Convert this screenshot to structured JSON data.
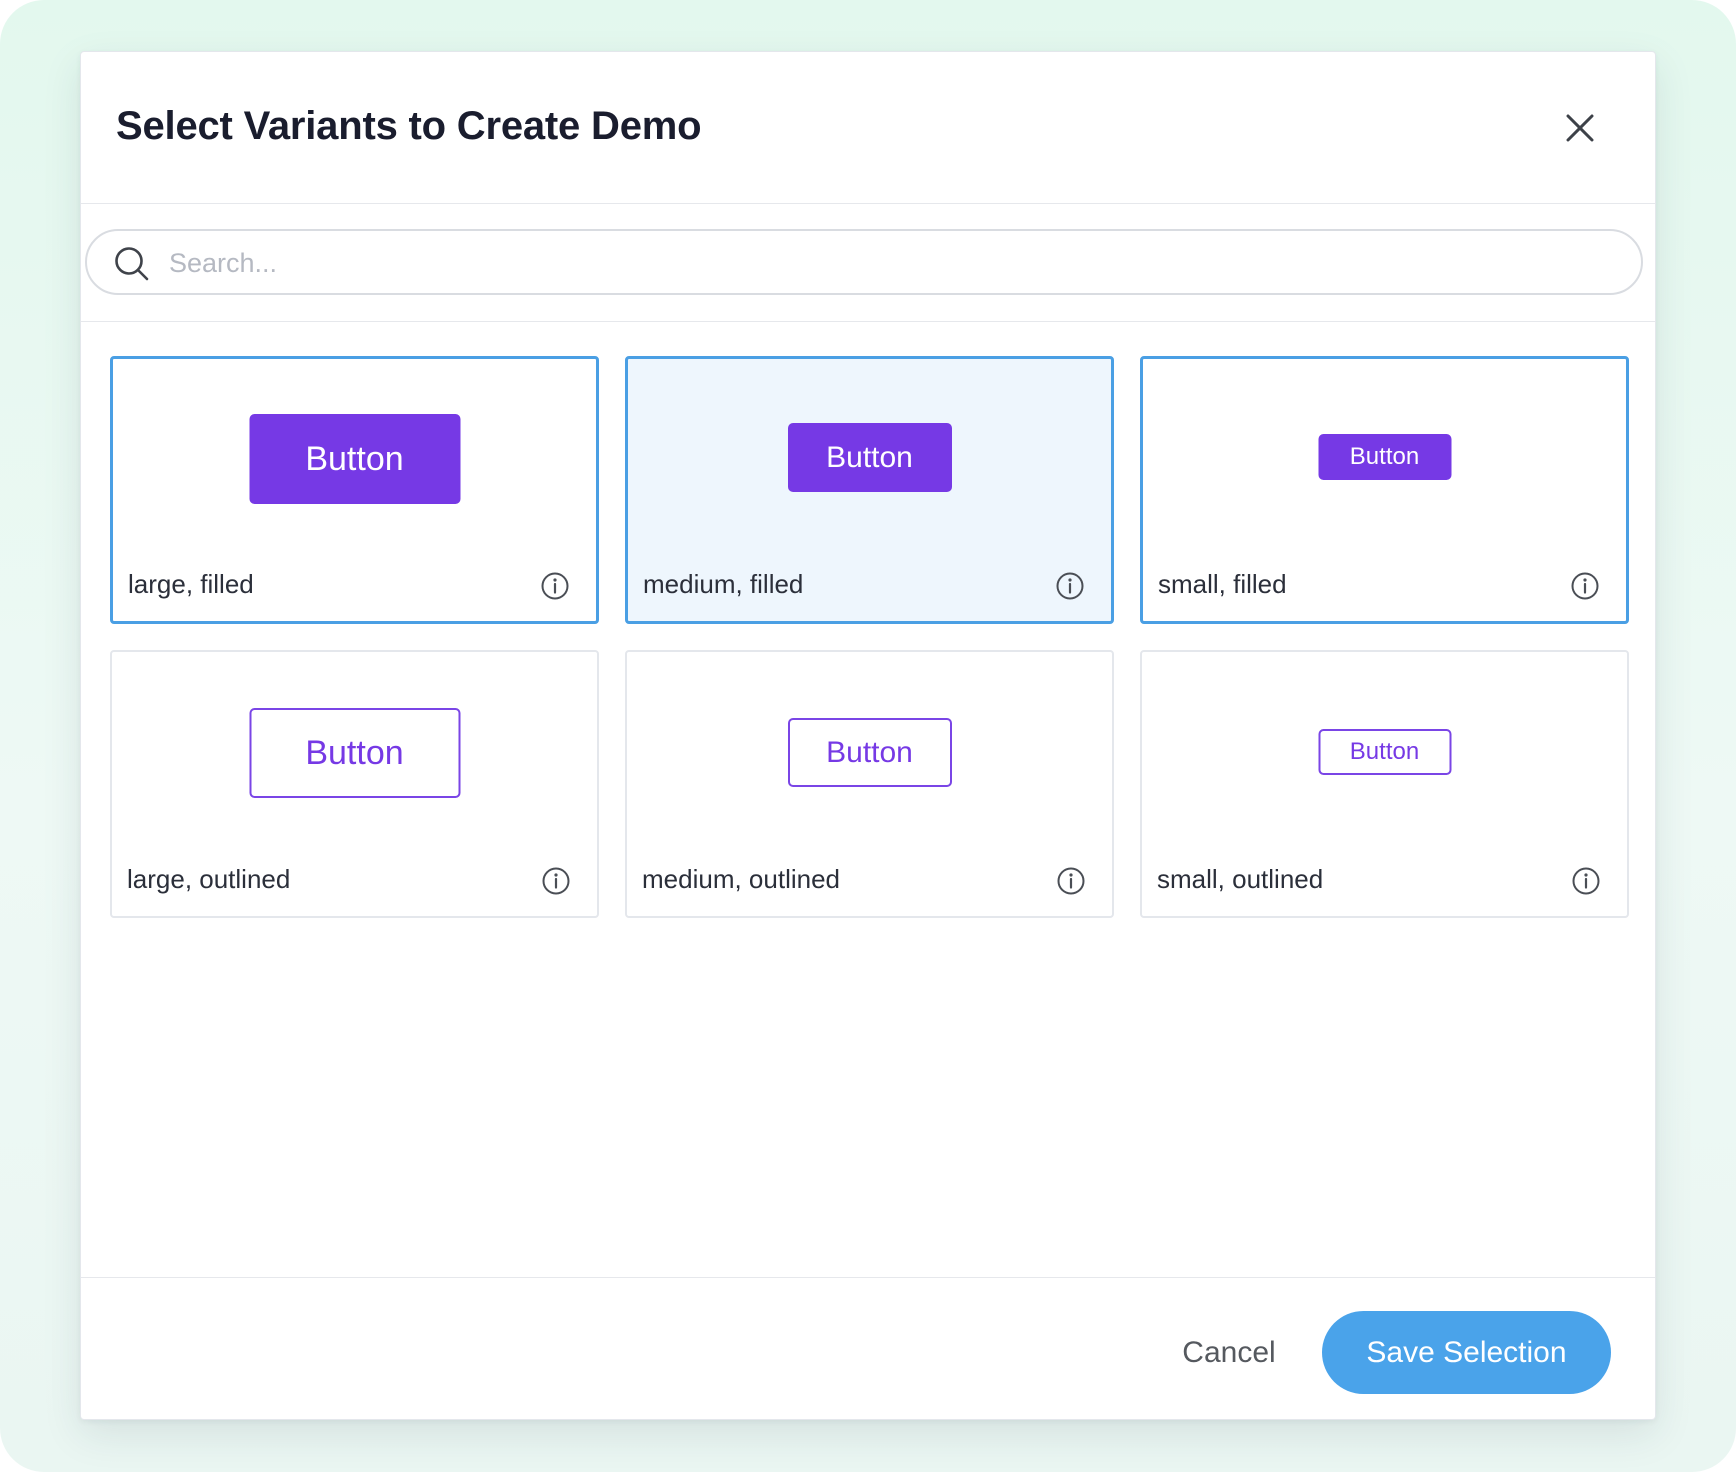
{
  "dialog": {
    "title": "Select Variants to Create Demo",
    "close_icon": "close-icon"
  },
  "search": {
    "placeholder": "Search...",
    "value": "",
    "icon": "search-icon"
  },
  "variants": [
    {
      "label": "large, filled",
      "button_text": "Button",
      "size": "large",
      "style": "filled",
      "selected": true
    },
    {
      "label": "medium, filled",
      "button_text": "Button",
      "size": "medium",
      "style": "filled",
      "selected": true
    },
    {
      "label": "small, filled",
      "button_text": "Button",
      "size": "small",
      "style": "filled",
      "selected": true
    },
    {
      "label": "large, outlined",
      "button_text": "Button",
      "size": "large",
      "style": "outlined",
      "selected": false
    },
    {
      "label": "medium, outlined",
      "button_text": "Button",
      "size": "medium",
      "style": "outlined",
      "selected": false
    },
    {
      "label": "small, outlined",
      "button_text": "Button",
      "size": "small",
      "style": "outlined",
      "selected": false
    }
  ],
  "footer": {
    "cancel_label": "Cancel",
    "save_label": "Save Selection"
  },
  "colors": {
    "primary_purple": "#7639e5",
    "selection_blue": "#4a9fe4",
    "hover_blue_bg": "#eef6fd",
    "save_button_blue": "#4aa3ea",
    "title_text": "#1a1d2e",
    "backdrop_green": "#e3f8ee"
  }
}
